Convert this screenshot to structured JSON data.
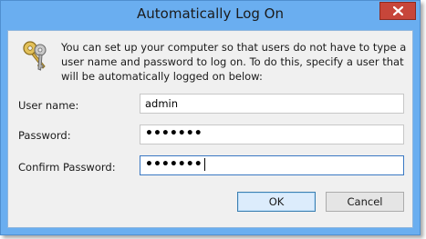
{
  "window": {
    "title": "Automatically Log On",
    "close_icon": "close-icon"
  },
  "dialog": {
    "icon": "keys-icon",
    "description": "You can set up your computer so that users do not have to type a user name and password to log on. To do this, specify a user that will be automatically logged on below:",
    "fields": {
      "username": {
        "label": "User name:",
        "value": "admin"
      },
      "password": {
        "label": "Password:",
        "value": "•••••••"
      },
      "confirm_password": {
        "label": "Confirm Password:",
        "value": "•••••••"
      }
    },
    "buttons": {
      "ok": "OK",
      "cancel": "Cancel"
    }
  },
  "colors": {
    "frame": "#6aaef0",
    "close_button": "#c7463a",
    "client_bg": "#f0f0f0"
  }
}
